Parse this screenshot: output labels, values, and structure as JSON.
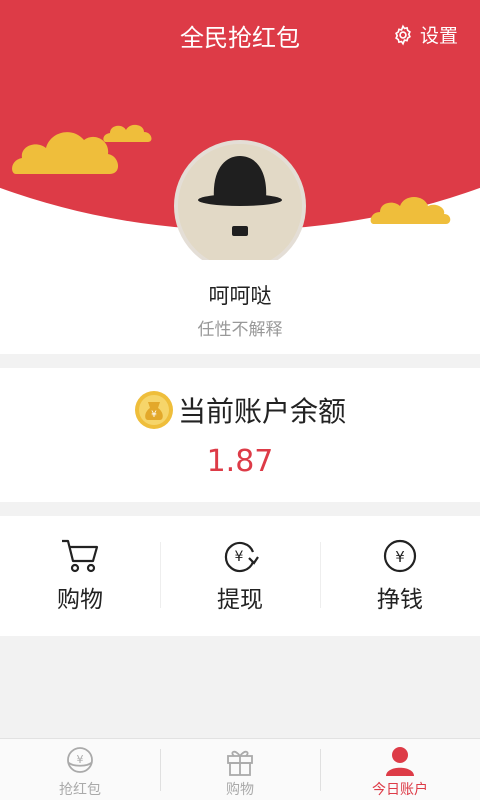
{
  "header": {
    "title": "全民抢红包",
    "settings_label": "设置"
  },
  "profile": {
    "name": "呵呵哒",
    "motto": "任性不解释"
  },
  "balance": {
    "label": "当前账户余额",
    "value": "1.87"
  },
  "actions": [
    {
      "label": "购物",
      "icon": "cart-icon"
    },
    {
      "label": "提现",
      "icon": "yuan-refresh-icon"
    },
    {
      "label": "挣钱",
      "icon": "yuan-circle-icon"
    }
  ],
  "tabbar": {
    "tabs": [
      {
        "label": "抢红包",
        "icon": "yuan-bowl-icon",
        "active": false
      },
      {
        "label": "购物",
        "icon": "gift-icon",
        "active": false
      },
      {
        "label": "今日账户",
        "icon": "user-icon",
        "active": true
      }
    ]
  },
  "colors": {
    "brand_red": "#dd3b47",
    "cloud_gold": "#efbe3b",
    "text_muted": "#999999"
  }
}
